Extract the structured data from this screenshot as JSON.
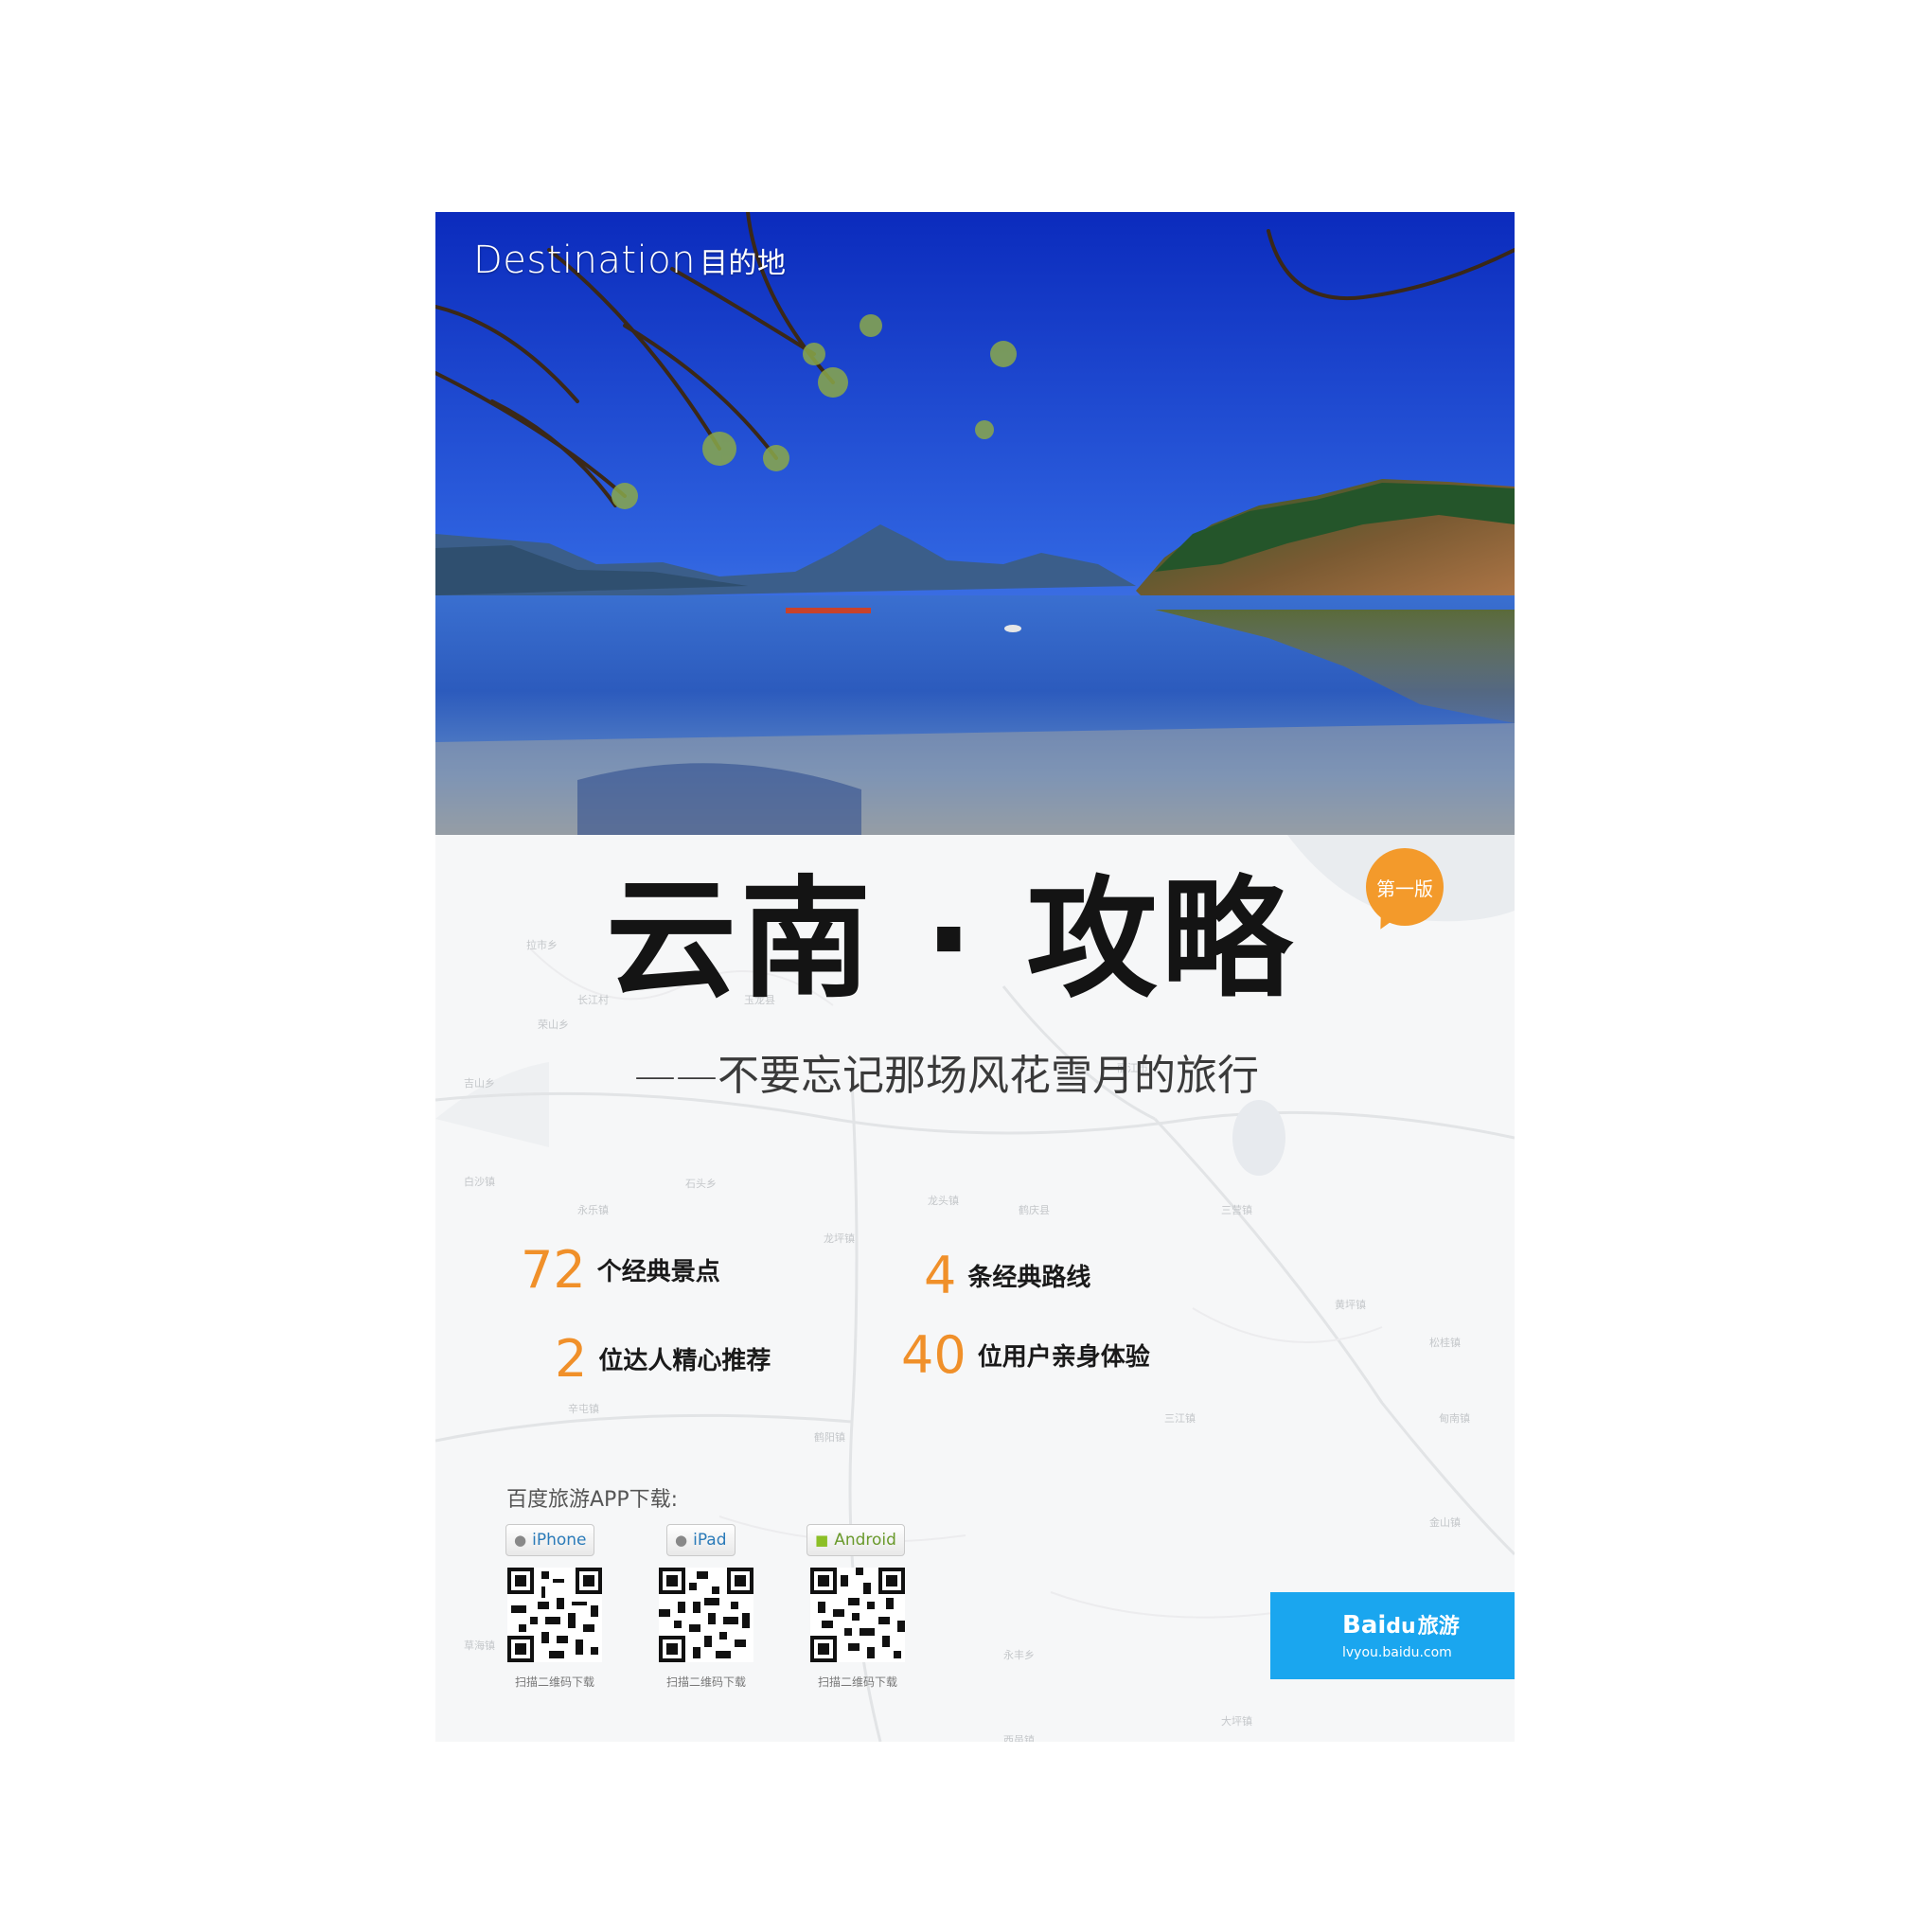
{
  "cover": {
    "destination_en": "Destination",
    "destination_cn": "目的地",
    "title": "云南 · 攻略",
    "edition_badge": "第一版",
    "subtitle": "——不要忘记那场风花雪月的旅行"
  },
  "stats": [
    {
      "number": "72",
      "label": "个经典景点"
    },
    {
      "number": "4",
      "label": "条经典路线"
    },
    {
      "number": "2",
      "label": "位达人精心推荐"
    },
    {
      "number": "40",
      "label": "位用户亲身体验"
    }
  ],
  "app_download": {
    "heading": "百度旅游APP下载:",
    "platforms": [
      {
        "name": "iPhone",
        "icon": "apple-icon",
        "caption": "扫描二维码下载"
      },
      {
        "name": "iPad",
        "icon": "apple-icon",
        "caption": "扫描二维码下载"
      },
      {
        "name": "Android",
        "icon": "android-icon",
        "caption": "扫描二维码下载"
      }
    ]
  },
  "logo": {
    "brand_left": "Bai",
    "brand_paw": "du",
    "brand_right": "旅游",
    "url": "lvyou.baidu.com",
    "color": "#1aa6ef"
  },
  "map_labels": [
    "拉市乡",
    "长江村",
    "荣山乡",
    "玉龙县",
    "吉山乡",
    "白沙镇",
    "永乐镇",
    "石头乡",
    "龙坪镇",
    "鹤庆县",
    "龙头镇",
    "三营镇",
    "丽江市",
    "黄坪镇",
    "大坪镇",
    "松桂镇",
    "三江镇",
    "甸南镇",
    "金山镇",
    "鹤阳镇",
    "辛屯镇",
    "永丰乡",
    "西邑镇",
    "草海镇"
  ],
  "colors": {
    "accent": "#f0902a",
    "badge": "#f39a2b",
    "title": "#141414"
  }
}
